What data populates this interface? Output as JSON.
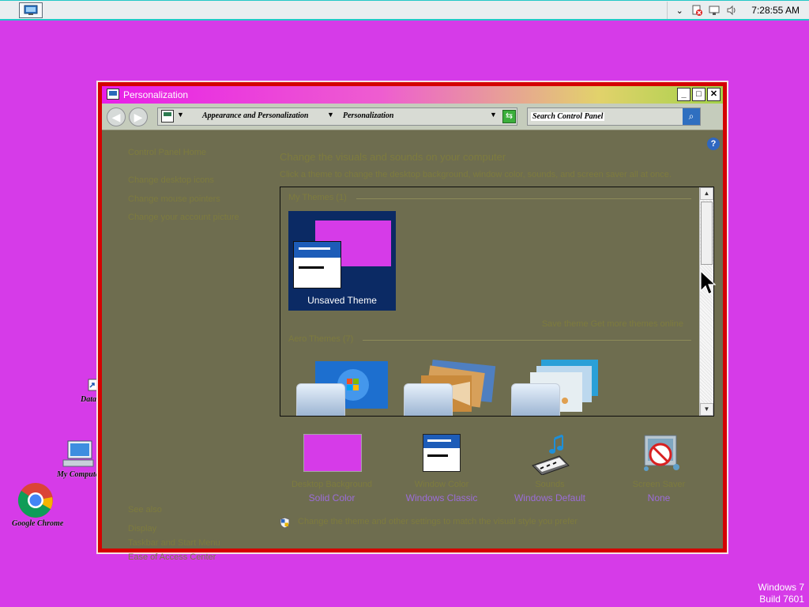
{
  "taskbar": {
    "clock": "7:28:55 AM"
  },
  "desktop": {
    "icons": [
      {
        "label": "Data",
        "icon": "shortcut-icon"
      },
      {
        "label": "My Computer",
        "icon": "computer-icon"
      },
      {
        "label": "Google Chrome",
        "icon": "chrome-icon"
      }
    ],
    "watermark": {
      "line1": "Windows 7",
      "line2": "Build 7601"
    }
  },
  "window": {
    "title": "Personalization",
    "controls": {
      "minimize": "_",
      "maximize": "□",
      "close": "✕"
    },
    "address": {
      "crumb1": "Appearance and Personalization",
      "crumb2": "Personalization",
      "search_placeholder": "Search Control Panel"
    },
    "sidebar": {
      "items": [
        "Control Panel Home",
        "Change desktop icons",
        "Change mouse pointers",
        "Change your account picture"
      ],
      "see_also_label": "See also",
      "see_also_items": [
        "Display",
        "Taskbar and Start Menu",
        "Ease of Access Center"
      ]
    },
    "main": {
      "heading": "Change the visuals and sounds on your computer",
      "description": "Click a theme to change the desktop background, window color, sounds, and screen saver all at once.",
      "my_themes_label": "My Themes (1)",
      "unsaved_theme": "Unsaved Theme",
      "save_theme_link": "Save theme    Get more themes online",
      "aero_themes_label": "Aero Themes (7)",
      "bottom_items": [
        {
          "top": "Desktop Background",
          "value": "Solid Color"
        },
        {
          "top": "Window Color",
          "value": "Windows Classic"
        },
        {
          "top": "Sounds",
          "value": "Windows Default"
        },
        {
          "top": "Screen Saver",
          "value": "None"
        }
      ],
      "uac_text": "Change the theme and other settings to match the visual style you prefer"
    }
  },
  "colors": {
    "desktop": "#d63be8",
    "window_content": "#6e6d4f",
    "frame": "#d40000",
    "muted_text": "#7d7b3e",
    "value_text": "#9b6dd8"
  }
}
